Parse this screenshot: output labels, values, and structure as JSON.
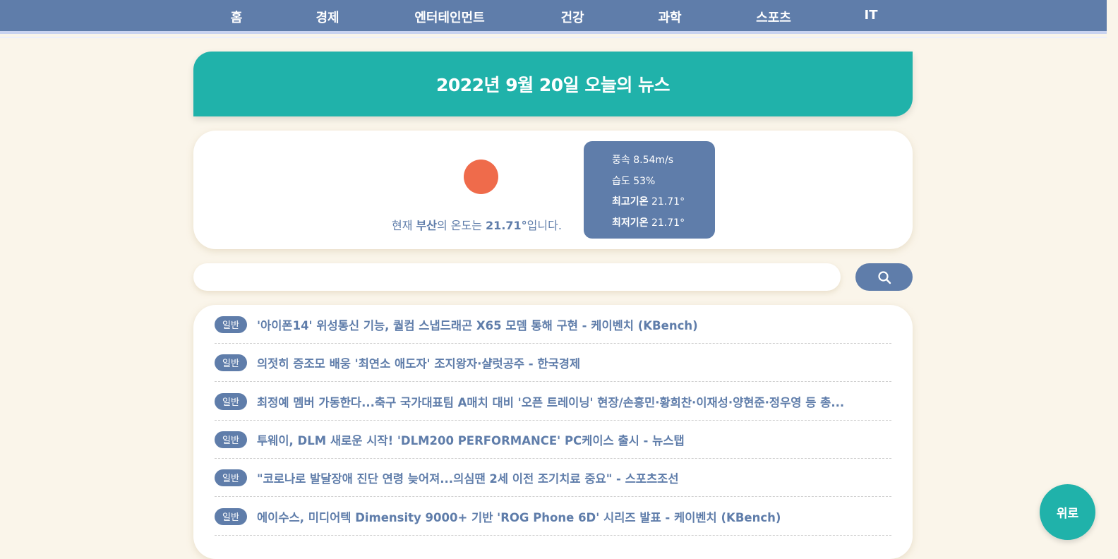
{
  "nav": {
    "items": [
      "홈",
      "경제",
      "엔터테인먼트",
      "건강",
      "과학",
      "스포츠",
      "IT"
    ]
  },
  "banner": {
    "title": "2022년 9월 20일 오늘의 뉴스"
  },
  "weather": {
    "icon": "sun-icon",
    "text_prefix": "현재 ",
    "city": "부산",
    "text_mid": "의 온도는 ",
    "temperature": "21.71°",
    "text_suffix": "입니다.",
    "wind": {
      "label": "풍속",
      "value": "8.54m/s"
    },
    "humidity": {
      "label": "습도",
      "value": "53%"
    },
    "max_temp": {
      "label": "최고기온",
      "value": "21.71°"
    },
    "min_temp": {
      "label": "최저기온",
      "value": "21.71°"
    }
  },
  "search": {
    "placeholder": "",
    "value": "",
    "icon": "search-icon"
  },
  "news": {
    "items": [
      {
        "badge": "일반",
        "title": "'아이폰14' 위성통신 기능, 퀄컴 스냅드래곤 X65 모뎀 통해 구현 - 케이벤치 (KBench)"
      },
      {
        "badge": "일반",
        "title": "의젓히 증조모 배웅 '최연소 애도자' 조지왕자·샬럿공주 - 한국경제"
      },
      {
        "badge": "일반",
        "title": "최정예 멤버 가동한다...축구 국가대표팀 A매치 대비 '오픈 트레이닝' 현장/손흥민·황희찬·이재성·양현준·정우영 등 총..."
      },
      {
        "badge": "일반",
        "title": "투웨이, DLM 새로운 시작! 'DLM200 PERFORMANCE' PC케이스 출시 - 뉴스탭"
      },
      {
        "badge": "일반",
        "title": "\"코로나로 발달장애 진단 연령 늦어져...의심땐 2세 이전 조기치료 중요\" - 스포츠조선"
      },
      {
        "badge": "일반",
        "title": "에이수스, 미디어텍 Dimensity 9000+ 기반 'ROG Phone 6D' 시리즈 발표 - 케이벤치 (KBench)"
      }
    ]
  },
  "scroll_top": {
    "label": "위로"
  },
  "colors": {
    "nav_bg": "#5f7daa",
    "teal": "#20b2aa",
    "sun": "#ef6b4b",
    "page_bg": "#faf5ea"
  }
}
